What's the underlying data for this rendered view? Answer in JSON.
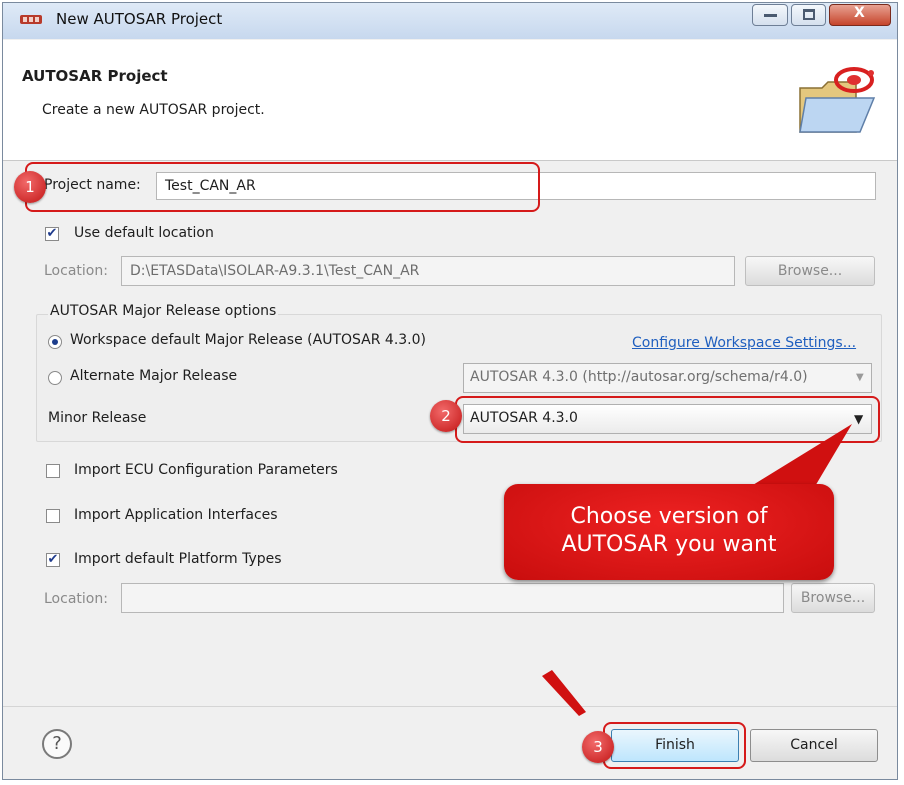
{
  "window": {
    "title": "New AUTOSAR Project",
    "minimize_glyph": "—",
    "maximize_glyph": "□",
    "close_glyph": "X"
  },
  "header": {
    "title": "AUTOSAR Project",
    "description": "Create a new AUTOSAR project."
  },
  "project": {
    "name_label": "Project name:",
    "name_value": "Test_CAN_AR"
  },
  "default_location": {
    "checkbox_label": "Use default location",
    "checked": true,
    "location_label": "Location:",
    "location_value": "D:\\ETASData\\ISOLAR-A9.3.1\\Test_CAN_AR",
    "browse_label": "Browse..."
  },
  "release_options": {
    "group_label": "AUTOSAR Major Release options",
    "workspace_default_label": "Workspace default Major Release (AUTOSAR 4.3.0)",
    "configure_link": "Configure Workspace Settings...",
    "alternate_label": "Alternate Major Release",
    "alternate_value": "AUTOSAR 4.3.0 (http://autosar.org/schema/r4.0)",
    "minor_release_label": "Minor Release",
    "minor_release_value": "AUTOSAR 4.3.0"
  },
  "imports": {
    "ecu_config_label": "Import ECU Configuration Parameters",
    "app_interfaces_label": "Import Application Interfaces",
    "platform_types_label": "Import default Platform Types",
    "location_label": "Location:",
    "location_value": "",
    "browse_label": "Browse..."
  },
  "annotations": {
    "badge_1": "1",
    "badge_2": "2",
    "badge_3": "3",
    "callout_line_1": "Choose version of",
    "callout_line_2": "AUTOSAR you want"
  },
  "footer": {
    "help_glyph": "?",
    "finish_label": "Finish",
    "cancel_label": "Cancel"
  },
  "colors": {
    "annotation_red": "#d51a1a",
    "link_blue": "#1f5fbf"
  }
}
